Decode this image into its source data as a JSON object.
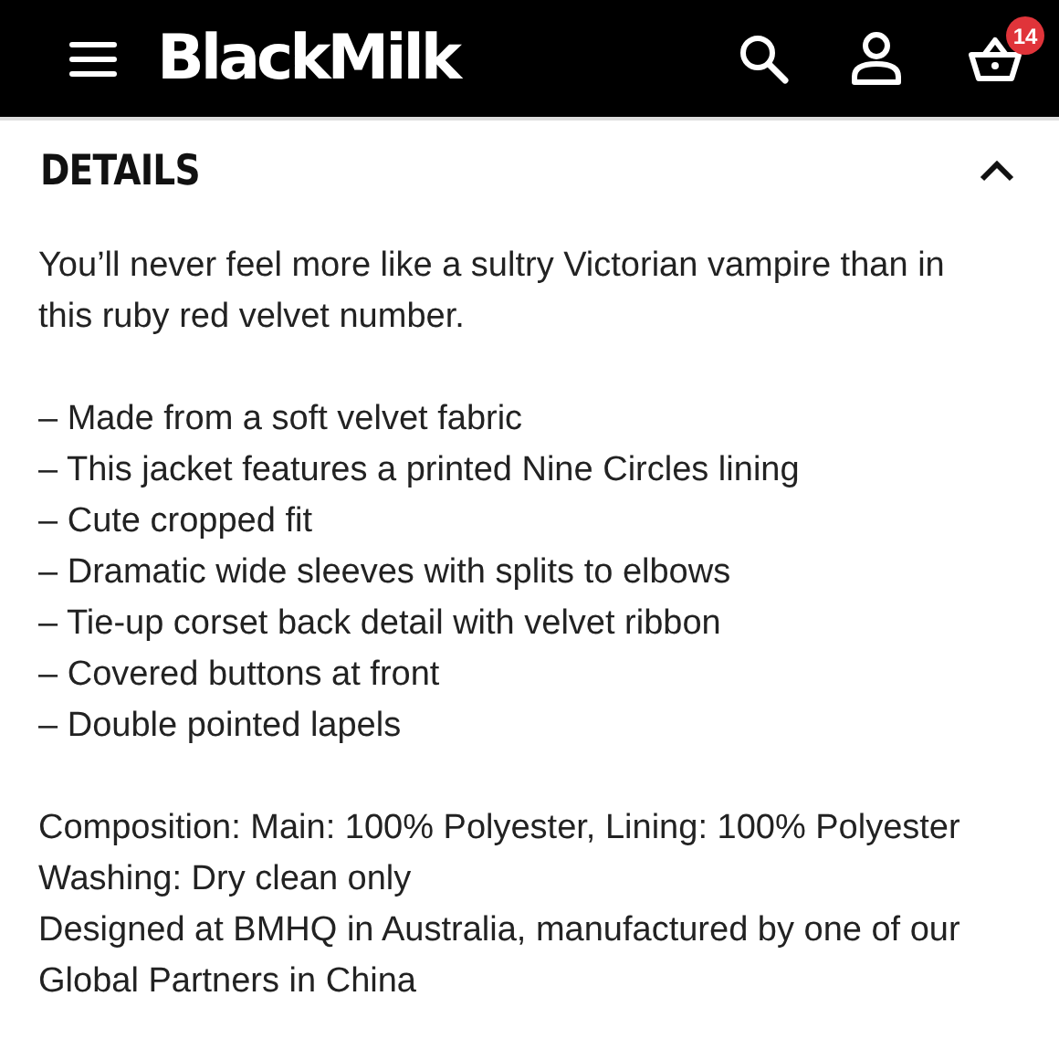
{
  "header": {
    "logo": "BlackMilk",
    "cart_count": "14"
  },
  "section": {
    "title": "DETAILS",
    "expanded": true,
    "intro": "You’ll never feel more like a sultry Victorian vampire than in this ruby red velvet number.",
    "features": [
      "– Made from a soft velvet fabric",
      "– This jacket features a printed Nine Circles lining",
      "– Cute cropped fit",
      "– Dramatic wide sleeves with splits to elbows",
      "– Tie-up corset back detail with velvet ribbon",
      "– Covered buttons at front",
      "– Double pointed lapels"
    ],
    "info": [
      "Composition: Main: 100% Polyester, Lining: 100% Polyester",
      "Washing: Dry clean only",
      "Designed at BMHQ in Australia, manufactured by one of our Global Partners in China"
    ]
  }
}
